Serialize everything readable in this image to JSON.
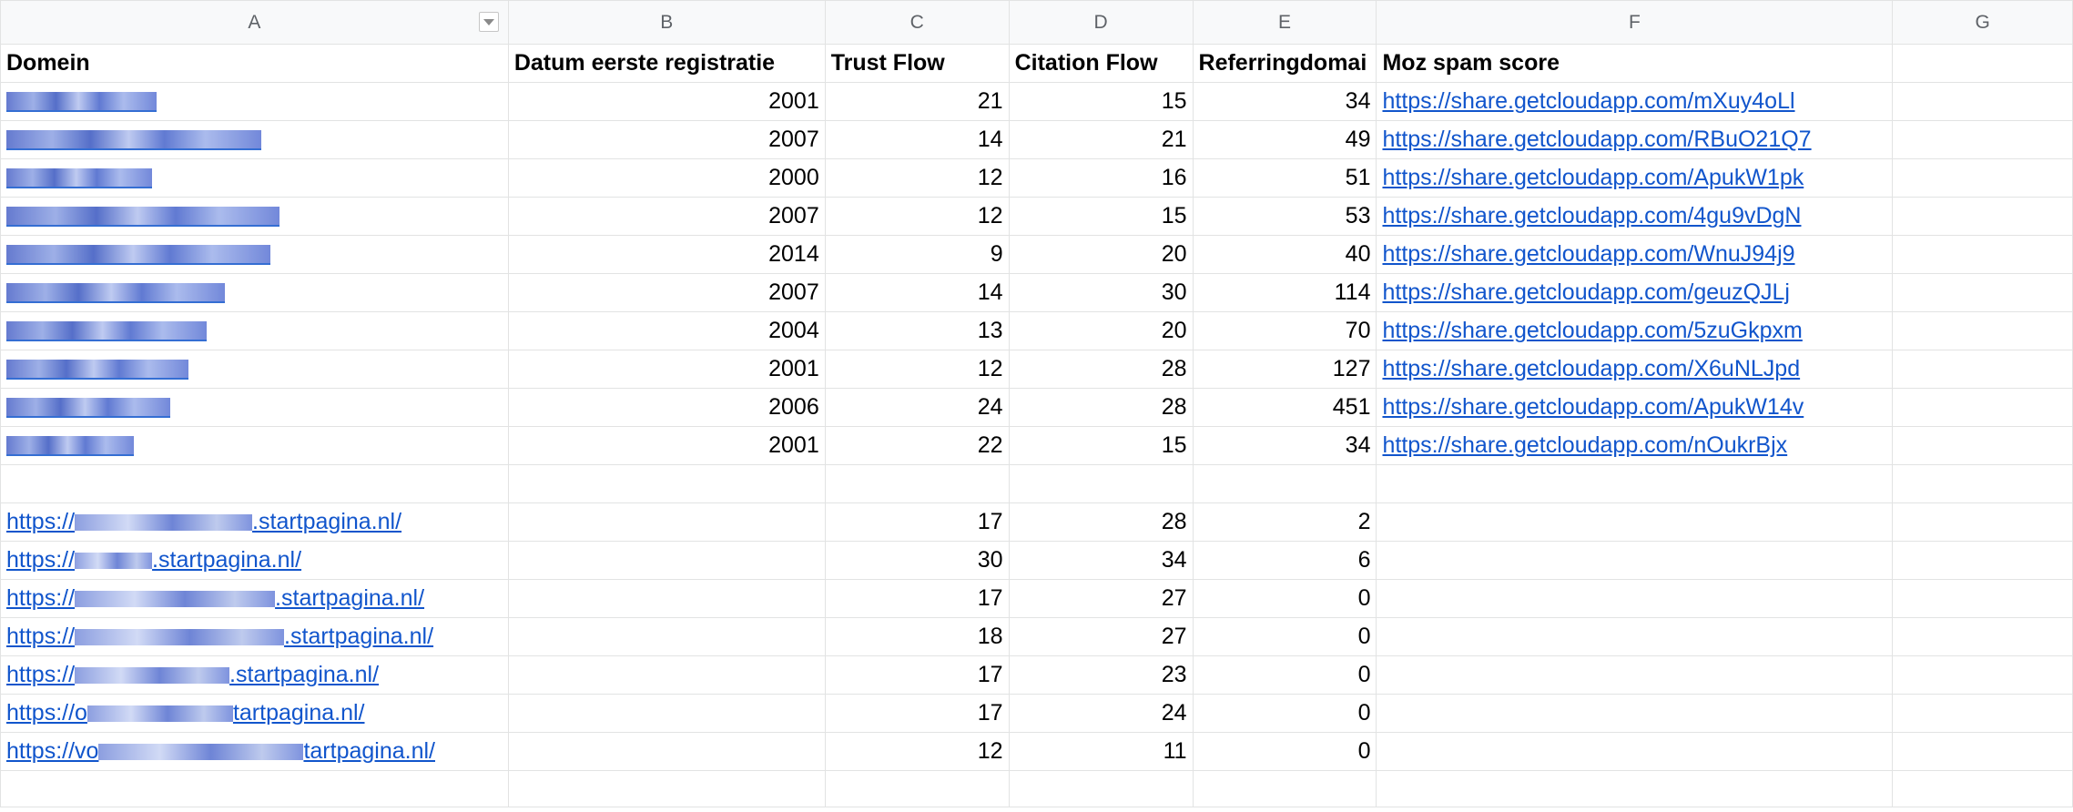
{
  "columns": [
    "A",
    "B",
    "C",
    "D",
    "E",
    "F",
    "G"
  ],
  "header": {
    "domain": "Domein",
    "registration": "Datum eerste registratie",
    "trust_flow": "Trust Flow",
    "citation_flow": "Citation Flow",
    "referring": "Referringdomai",
    "moz": "Moz spam score"
  },
  "rows": [
    {
      "year": "2001",
      "trust": "21",
      "citation": "15",
      "referring": "34",
      "link": "https://share.getcloudapp.com/mXuy4oLl"
    },
    {
      "year": "2007",
      "trust": "14",
      "citation": "21",
      "referring": "49",
      "link": "https://share.getcloudapp.com/RBuO21Q7"
    },
    {
      "year": "2000",
      "trust": "12",
      "citation": "16",
      "referring": "51",
      "link": "https://share.getcloudapp.com/ApukW1pk"
    },
    {
      "year": "2007",
      "trust": "12",
      "citation": "15",
      "referring": "53",
      "link": "https://share.getcloudapp.com/4gu9vDgN"
    },
    {
      "year": "2014",
      "trust": "9",
      "citation": "20",
      "referring": "40",
      "link": "https://share.getcloudapp.com/WnuJ94j9"
    },
    {
      "year": "2007",
      "trust": "14",
      "citation": "30",
      "referring": "114",
      "link": "https://share.getcloudapp.com/geuzQJLj"
    },
    {
      "year": "2004",
      "trust": "13",
      "citation": "20",
      "referring": "70",
      "link": "https://share.getcloudapp.com/5zuGkpxm"
    },
    {
      "year": "2001",
      "trust": "12",
      "citation": "28",
      "referring": "127",
      "link": "https://share.getcloudapp.com/X6uNLJpd"
    },
    {
      "year": "2006",
      "trust": "24",
      "citation": "28",
      "referring": "451",
      "link": "https://share.getcloudapp.com/ApukW14v"
    },
    {
      "year": "2001",
      "trust": "22",
      "citation": "15",
      "referring": "34",
      "link": "https://share.getcloudapp.com/nOukrBjx"
    }
  ],
  "startpagina_rows": [
    {
      "prefix": "https://",
      "suffix": ".startpagina.nl/",
      "trust": "17",
      "citation": "28",
      "referring": "2"
    },
    {
      "prefix": "https://",
      "suffix": ".startpagina.nl/",
      "trust": "30",
      "citation": "34",
      "referring": "6"
    },
    {
      "prefix": "https://",
      "suffix": ".startpagina.nl/",
      "trust": "17",
      "citation": "27",
      "referring": "0"
    },
    {
      "prefix": "https://",
      "suffix": ".startpagina.nl/",
      "trust": "18",
      "citation": "27",
      "referring": "0"
    },
    {
      "prefix": "https://",
      "suffix": ".startpagina.nl/",
      "trust": "17",
      "citation": "23",
      "referring": "0"
    },
    {
      "prefix": "https://o",
      "suffix": "tartpagina.nl/",
      "trust": "17",
      "citation": "24",
      "referring": "0"
    },
    {
      "prefix": "https://vo",
      "suffix": "tartpagina.nl/",
      "trust": "12",
      "citation": "11",
      "referring": "0"
    }
  ]
}
